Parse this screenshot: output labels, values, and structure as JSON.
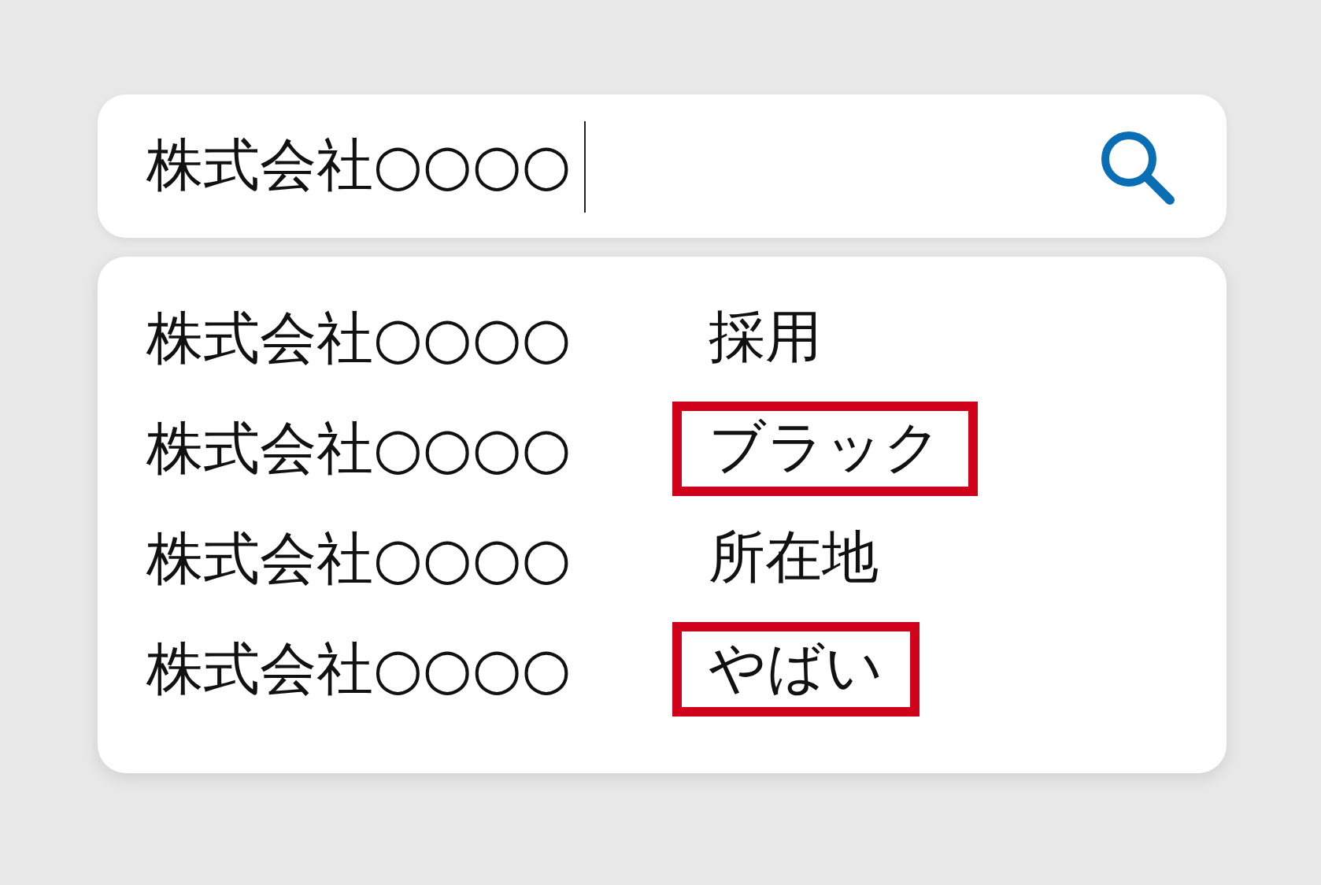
{
  "search": {
    "value": "株式会社○○○○"
  },
  "suggestions": [
    {
      "query": "株式会社○○○○",
      "keyword": "採用",
      "highlighted": false
    },
    {
      "query": "株式会社○○○○",
      "keyword": "ブラック",
      "highlighted": true
    },
    {
      "query": "株式会社○○○○",
      "keyword": "所在地",
      "highlighted": false
    },
    {
      "query": "株式会社○○○○",
      "keyword": "やばい",
      "highlighted": true
    }
  ]
}
